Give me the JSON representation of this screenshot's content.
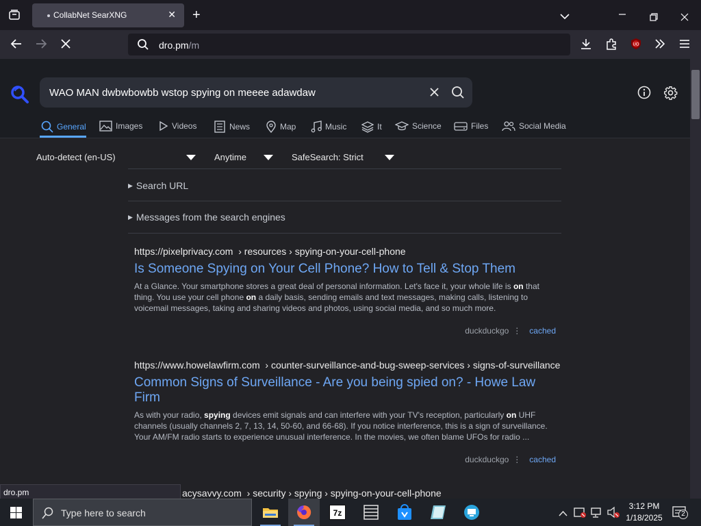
{
  "browser": {
    "tab_title": "CollabNet SearXNG",
    "url_host": "dro.pm",
    "url_path": "/m",
    "status_text": "dro.pm"
  },
  "search": {
    "query": "WAO MAN dwbwbowbb wstop spying on meeee adawdaw"
  },
  "categories": [
    {
      "label": "General",
      "icon": "search-icon"
    },
    {
      "label": "Images",
      "icon": "image-icon"
    },
    {
      "label": "Videos",
      "icon": "play-icon"
    },
    {
      "label": "News",
      "icon": "newspaper-icon"
    },
    {
      "label": "Map",
      "icon": "map-pin-icon"
    },
    {
      "label": "Music",
      "icon": "music-icon"
    },
    {
      "label": "It",
      "icon": "layers-icon"
    },
    {
      "label": "Science",
      "icon": "graduation-cap-icon"
    },
    {
      "label": "Files",
      "icon": "drive-icon"
    },
    {
      "label": "Social Media",
      "icon": "users-icon"
    }
  ],
  "filters": {
    "language": "Auto-detect (en-US)",
    "time": "Anytime",
    "safesearch": "SafeSearch: Strict"
  },
  "collapsibles": {
    "search_url": "Search URL",
    "messages": "Messages from the search engines"
  },
  "results": [
    {
      "url_host": "https://pixelprivacy.com",
      "url_path": "› resources › spying-on-your-cell-phone",
      "title": "Is Someone Spying on Your Cell Phone? How to Tell & Stop Them",
      "snippet_1": "At a Glance. Your smartphone stores a great deal of personal information. Let's face it, your whole life is ",
      "snippet_b1": "on",
      "snippet_2": " that thing. You use your cell phone ",
      "snippet_b2": "on",
      "snippet_3": " a daily basis, sending emails and text messages, making calls, listening to voicemail messages, taking and sharing videos and photos, using social media, and so much more.",
      "engine": "duckduckgo",
      "cached": "cached"
    },
    {
      "url_host": "https://www.howelawfirm.com",
      "url_path": "› counter-surveillance-and-bug-sweep-services › signs-of-surveillance",
      "title": "Common Signs of Surveillance - Are you being spied on? - Howe Law Firm",
      "snippet_1": "As with your radio, ",
      "snippet_b1": "spying",
      "snippet_2": " devices emit signals and can interfere with your TV's reception, particularly ",
      "snippet_b2": "on",
      "snippet_3": " UHF channels (usually channels 2, 7, 13, 14, 50-60, and 66-68). If you notice interference, this is a sign of surveillance. Your AM/FM radio starts to experience unusual interference. In the movies, we often blame UFOs for radio ...",
      "engine": "duckduckgo",
      "cached": "cached"
    },
    {
      "url_host": "acysavvy.com",
      "url_path": "› security › spying › spying-on-your-cell-phone"
    }
  ],
  "taskbar": {
    "search_placeholder": "Type here to search",
    "time": "3:12 PM",
    "date": "1/18/2025",
    "notification_count": "2"
  },
  "colors": {
    "accent": "#58a6ff",
    "link": "#6ea7f4",
    "page_bg": "#222226"
  }
}
